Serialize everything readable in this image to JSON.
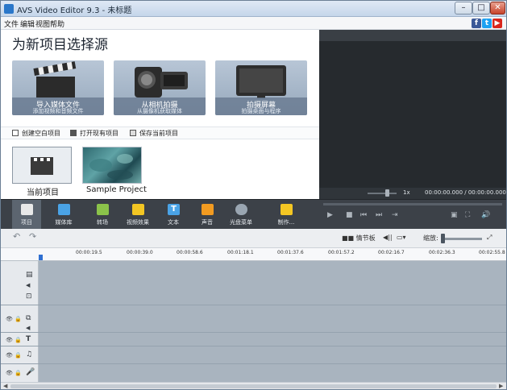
{
  "window": {
    "title": "AVS Video Editor 9.3 - 未标题"
  },
  "menu": {
    "items": [
      "文件",
      "编辑",
      "视图",
      "帮助"
    ]
  },
  "social": [
    {
      "name": "facebook",
      "glyph": "f",
      "color": "#3b5998"
    },
    {
      "name": "twitter",
      "glyph": "t",
      "color": "#1da1f2"
    },
    {
      "name": "youtube",
      "glyph": "▶",
      "color": "#d9261c"
    }
  ],
  "start": {
    "heading": "为新项目选择源",
    "tiles": [
      {
        "title": "导入媒体文件",
        "subtitle": "添加视频和音频文件",
        "icon": "clapperboard-icon"
      },
      {
        "title": "从相机拍摄",
        "subtitle": "从摄像机获取媒体",
        "icon": "camcorder-icon"
      },
      {
        "title": "拍摄屏幕",
        "subtitle": "拍摄桌面与程序",
        "icon": "monitor-icon"
      }
    ],
    "actions": [
      {
        "label": "创建空白项目",
        "icon": "new-page-icon"
      },
      {
        "label": "打开现有项目",
        "icon": "folder-icon"
      },
      {
        "label": "保存当前项目",
        "icon": "save-icon"
      }
    ],
    "recent": [
      {
        "label": "当前项目"
      },
      {
        "label": "Sample Project"
      }
    ]
  },
  "preview": {
    "speed": "1x",
    "time": "00:00:00.000 / 00:00:00.000"
  },
  "toolbar": {
    "tools": [
      {
        "label": "项目",
        "icon": "project-icon",
        "color": "#e8e8e8"
      },
      {
        "label": "媒体库",
        "icon": "media-library-icon",
        "color": "#4aa3e6"
      },
      {
        "label": "转场",
        "icon": "transition-icon",
        "color": "#8bc34a"
      },
      {
        "label": "视频效果",
        "icon": "video-effects-icon",
        "color": "#f3c623"
      },
      {
        "label": "文本",
        "icon": "text-icon",
        "color": "#4aa3e6"
      },
      {
        "label": "声音",
        "icon": "sound-icon",
        "color": "#f29b21"
      },
      {
        "label": "光盘菜单",
        "icon": "disc-menu-icon",
        "color": "#9aa6b2"
      },
      {
        "label": "制作...",
        "icon": "produce-icon",
        "color": "#f3c623"
      }
    ]
  },
  "timeline": {
    "storyboard_label": "情节板",
    "zoom_label": "缩放:",
    "zoom_level": 0.0,
    "ruler": [
      "00:00:19.5",
      "00:00:39.0",
      "00:00:58.6",
      "00:01:18.1",
      "00:01:37.6",
      "00:01:57.2",
      "00:02:16.7",
      "00:02:36.3",
      "00:02:55.8"
    ]
  }
}
